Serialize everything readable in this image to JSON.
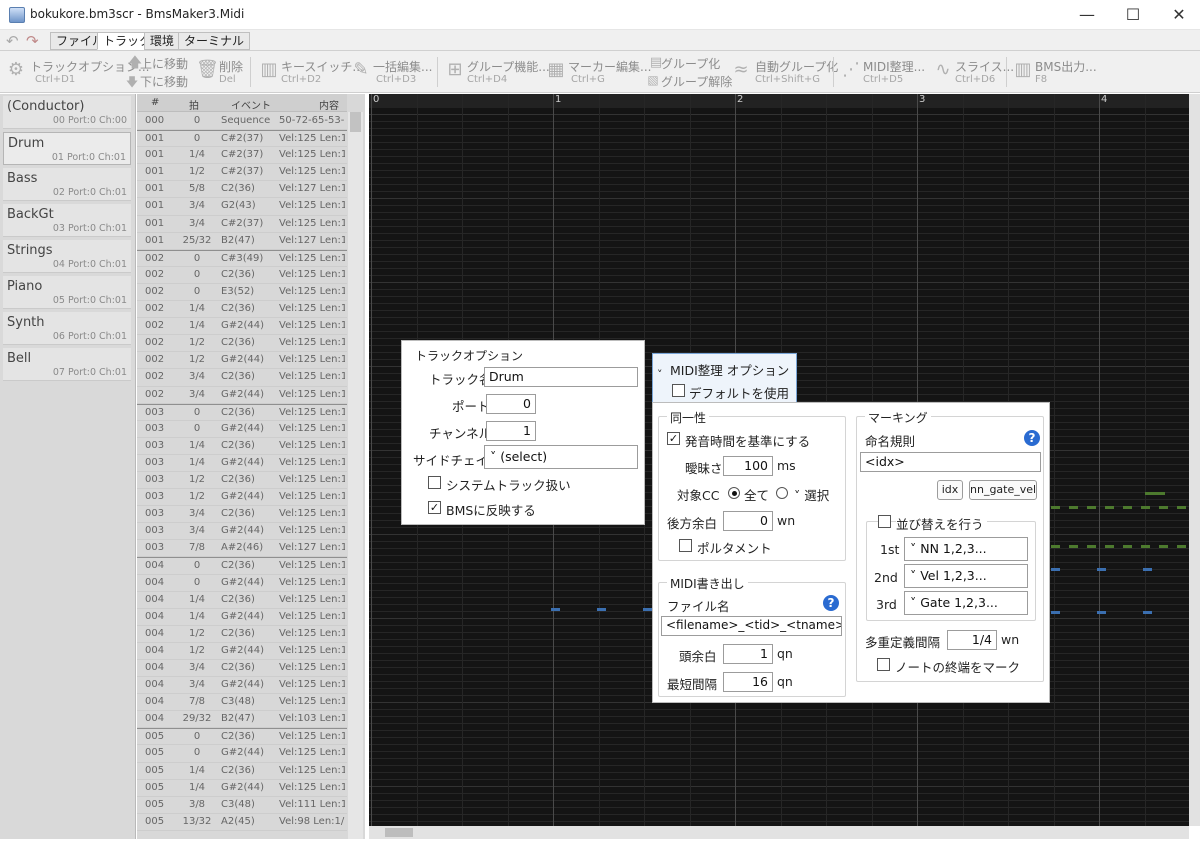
{
  "window": {
    "title": "bokukore.bm3scr - BmsMaker3.Midi",
    "minimize": "—",
    "maximize": "☐",
    "close": "✕"
  },
  "menu": {
    "undo": "↶",
    "redo": "↷",
    "tabs": [
      "ファイル",
      "トラック",
      "環境",
      "ターミナル"
    ]
  },
  "toolbar": {
    "track_option": {
      "label": "トラックオプション...",
      "shortcut": "Ctrl+D1"
    },
    "move_up": "上に移動",
    "move_down": "下に移動",
    "delete": {
      "label": "削除",
      "shortcut": "Del"
    },
    "key_switch": {
      "label": "キースイッチ...",
      "shortcut": "Ctrl+D2"
    },
    "bulk_edit": {
      "label": "一括編集...",
      "shortcut": "Ctrl+D3"
    },
    "group_func": {
      "label": "グループ機能...",
      "shortcut": "Ctrl+D4"
    },
    "marker_edit": {
      "label": "マーカー編集...",
      "shortcut": "Ctrl+G"
    },
    "group": "グループ化",
    "ungroup": "グループ解除",
    "auto_group": {
      "label": "自動グループ化",
      "shortcut": "Ctrl+Shift+G"
    },
    "midi_arrange": {
      "label": "MIDI整理...",
      "shortcut": "Ctrl+D5"
    },
    "slice": {
      "label": "スライス...",
      "shortcut": "Ctrl+D6"
    },
    "bms_output": {
      "label": "BMS出力...",
      "shortcut": "F8"
    }
  },
  "tracks": [
    {
      "name": "(Conductor)",
      "port": "00 Port:0 Ch:00"
    },
    {
      "name": "Drum",
      "port": "01 Port:0 Ch:01"
    },
    {
      "name": "Bass",
      "port": "02 Port:0 Ch:01"
    },
    {
      "name": "BackGt",
      "port": "03 Port:0 Ch:01"
    },
    {
      "name": "Strings",
      "port": "04 Port:0 Ch:01"
    },
    {
      "name": "Piano",
      "port": "05 Port:0 Ch:01"
    },
    {
      "name": "Synth",
      "port": "06 Port:0 Ch:01"
    },
    {
      "name": "Bell",
      "port": "07 Port:0 Ch:01"
    }
  ],
  "events": {
    "headers": [
      "#",
      "拍",
      "イベント",
      "内容"
    ],
    "rows": [
      [
        "000",
        "0",
        "Sequence",
        "50-72-65-53-0"
      ],
      [
        "001",
        "0",
        "C#2(37)",
        "Vel:125 Len:1/1"
      ],
      [
        "001",
        "1/4",
        "C#2(37)",
        "Vel:125 Len:1/1"
      ],
      [
        "001",
        "1/2",
        "C#2(37)",
        "Vel:125 Len:1/1"
      ],
      [
        "001",
        "5/8",
        "C2(36)",
        "Vel:127 Len:1/1"
      ],
      [
        "001",
        "3/4",
        "G2(43)",
        "Vel:125 Len:1/1"
      ],
      [
        "001",
        "3/4",
        "C#2(37)",
        "Vel:125 Len:1/1"
      ],
      [
        "001",
        "25/32",
        "B2(47)",
        "Vel:127 Len:1/1"
      ],
      [
        "002",
        "0",
        "C#3(49)",
        "Vel:125 Len:1/1"
      ],
      [
        "002",
        "0",
        "C2(36)",
        "Vel:125 Len:1/1"
      ],
      [
        "002",
        "0",
        "E3(52)",
        "Vel:125 Len:1/1"
      ],
      [
        "002",
        "1/4",
        "C2(36)",
        "Vel:125 Len:1/1"
      ],
      [
        "002",
        "1/4",
        "G#2(44)",
        "Vel:125 Len:1/1"
      ],
      [
        "002",
        "1/2",
        "C2(36)",
        "Vel:125 Len:1/1"
      ],
      [
        "002",
        "1/2",
        "G#2(44)",
        "Vel:125 Len:1/1"
      ],
      [
        "002",
        "3/4",
        "C2(36)",
        "Vel:125 Len:1/1"
      ],
      [
        "002",
        "3/4",
        "G#2(44)",
        "Vel:125 Len:1/1"
      ],
      [
        "003",
        "0",
        "C2(36)",
        "Vel:125 Len:1/1"
      ],
      [
        "003",
        "0",
        "G#2(44)",
        "Vel:125 Len:1/1"
      ],
      [
        "003",
        "1/4",
        "C2(36)",
        "Vel:125 Len:1/1"
      ],
      [
        "003",
        "1/4",
        "G#2(44)",
        "Vel:125 Len:1/1"
      ],
      [
        "003",
        "1/2",
        "C2(36)",
        "Vel:125 Len:1/1"
      ],
      [
        "003",
        "1/2",
        "G#2(44)",
        "Vel:125 Len:1/1"
      ],
      [
        "003",
        "3/4",
        "C2(36)",
        "Vel:125 Len:1/1"
      ],
      [
        "003",
        "3/4",
        "G#2(44)",
        "Vel:125 Len:1/1"
      ],
      [
        "003",
        "7/8",
        "A#2(46)",
        "Vel:127 Len:1/1"
      ],
      [
        "004",
        "0",
        "C2(36)",
        "Vel:125 Len:1/1"
      ],
      [
        "004",
        "0",
        "G#2(44)",
        "Vel:125 Len:1/1"
      ],
      [
        "004",
        "1/4",
        "C2(36)",
        "Vel:125 Len:1/1"
      ],
      [
        "004",
        "1/4",
        "G#2(44)",
        "Vel:125 Len:1/1"
      ],
      [
        "004",
        "1/2",
        "C2(36)",
        "Vel:125 Len:1/1"
      ],
      [
        "004",
        "1/2",
        "G#2(44)",
        "Vel:125 Len:1/1"
      ],
      [
        "004",
        "3/4",
        "C2(36)",
        "Vel:125 Len:1/1"
      ],
      [
        "004",
        "3/4",
        "G#2(44)",
        "Vel:125 Len:1/1"
      ],
      [
        "004",
        "7/8",
        "C3(48)",
        "Vel:125 Len:1/1"
      ],
      [
        "004",
        "29/32",
        "B2(47)",
        "Vel:103 Len:1/1"
      ],
      [
        "005",
        "0",
        "C2(36)",
        "Vel:125 Len:1/1"
      ],
      [
        "005",
        "0",
        "G#2(44)",
        "Vel:125 Len:1/1"
      ],
      [
        "005",
        "1/4",
        "C2(36)",
        "Vel:125 Len:1/1"
      ],
      [
        "005",
        "1/4",
        "G#2(44)",
        "Vel:125 Len:1/1"
      ],
      [
        "005",
        "3/8",
        "C3(48)",
        "Vel:111 Len:1/1"
      ],
      [
        "005",
        "13/32",
        "A2(45)",
        "Vel:98 Len:1/16"
      ]
    ]
  },
  "pianoroll": {
    "measures": [
      "0",
      "1",
      "2",
      "3",
      "4"
    ]
  },
  "track_option": {
    "legend": "トラックオプション",
    "name_label": "トラック名",
    "name_value": "Drum",
    "port_label": "ポート",
    "port_value": "0",
    "channel_label": "チャンネル",
    "channel_value": "1",
    "sidechain_label": "サイドチェイン",
    "sidechain_value": "˅ (select)",
    "system_track_label": "システムトラック扱い",
    "system_track_checked": "",
    "reflect_bms_label": "BMSに反映する",
    "reflect_bms_checked": "✓"
  },
  "midi_option": {
    "header_label": "MIDI整理 オプション",
    "header_chevron": "˅",
    "use_default_label": "デフォルトを使用",
    "use_default_checked": "",
    "identity": {
      "legend": "同一性",
      "onset_label": "発音時間を基準にする",
      "onset_checked": "✓",
      "ambiguity_label": "曖昧さ",
      "ambiguity_value": "100",
      "ambiguity_unit": "ms",
      "target_cc_label": "対象CC",
      "all_label": "全て",
      "select_label": "˅ 選択",
      "rear_margin_label": "後方余白",
      "rear_margin_value": "0",
      "rear_margin_unit": "wn",
      "portamento_label": "ポルタメント",
      "portamento_checked": ""
    },
    "export": {
      "legend": "MIDI書き出し",
      "filename_label": "ファイル名",
      "filename_value": "<filename>_<tid>_<tname>",
      "head_margin_label": "頭余白",
      "head_margin_value": "1",
      "head_margin_unit": "qn",
      "min_interval_label": "最短間隔",
      "min_interval_value": "16",
      "min_interval_unit": "qn"
    },
    "marking": {
      "legend": "マーキング",
      "naming_label": "命名規則",
      "naming_value": "<idx>",
      "btn_idx": "idx",
      "btn_nn_gate_vel": "nn_gate_vel",
      "sort_label": "並び替えを行う",
      "sort_checked": "",
      "first_label": "1st",
      "first_value": "˅ NN 1,2,3...",
      "second_label": "2nd",
      "second_value": "˅ Vel 1,2,3...",
      "third_label": "3rd",
      "third_value": "˅ Gate 1,2,3...",
      "multi_interval_label": "多重定義間隔",
      "multi_interval_value": "1/4",
      "multi_interval_unit": "wn",
      "mark_end_label": "ノートの終端をマーク",
      "mark_end_checked": ""
    },
    "help_glyph": "?"
  }
}
